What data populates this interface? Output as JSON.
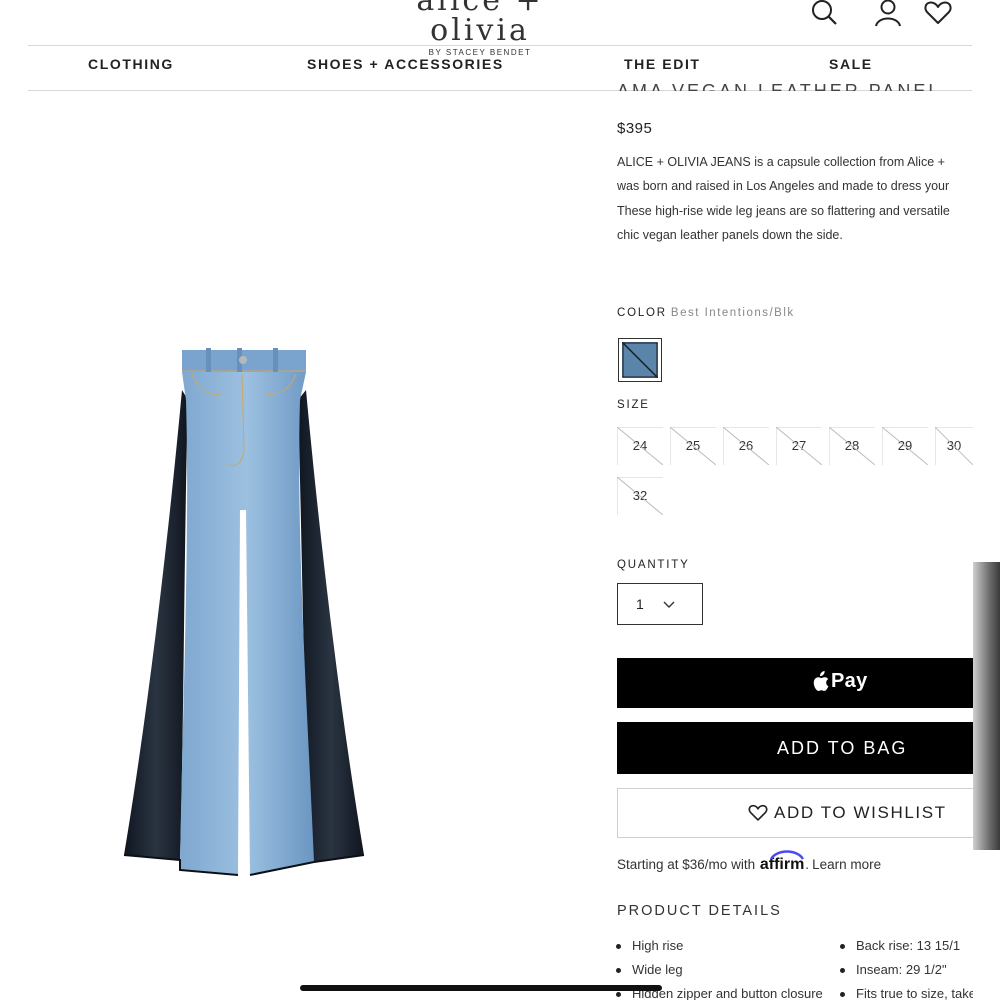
{
  "header": {
    "logo_main": "alice + olivia",
    "logo_sub": "BY STACEY BENDET",
    "icons": [
      "search-icon",
      "account-icon",
      "wishlist-heart-icon"
    ]
  },
  "nav": {
    "items": [
      "CLOTHING",
      "SHOES + ACCESSORIES",
      "THE EDIT",
      "SALE"
    ]
  },
  "product": {
    "title_partial": "AMA VEGAN LEATHER PANEL",
    "price": "$395",
    "description_lines": [
      "ALICE + OLIVIA JEANS is a capsule collection from Alice +",
      "was born and raised in Los Angeles and made to dress your",
      "These high-rise wide leg jeans are so flattering and versatile",
      "chic vegan leather panels down the side."
    ],
    "color_label": "COLOR",
    "color_value": "Best Intentions/Blk",
    "swatch_color": "#5b84aa",
    "size_label": "SIZE",
    "sizes": [
      "24",
      "25",
      "26",
      "27",
      "28",
      "29",
      "30",
      "32"
    ],
    "quantity_label": "QUANTITY",
    "quantity_value": "1",
    "apple_pay_label": "Pay",
    "add_to_bag_label": "ADD TO BAG",
    "add_to_wishlist_label": "ADD TO WISHLIST",
    "affirm_prefix": "Starting at $36/mo with",
    "affirm_brand": "affirm",
    "affirm_suffix": ".",
    "affirm_learn_more": "Learn more",
    "details_title": "PRODUCT DETAILS",
    "details_left": [
      "High rise",
      "Wide leg",
      "Hidden zipper and button closure"
    ],
    "details_right": [
      "Back rise: 13 15/1",
      "Inseam: 29 1/2\"",
      "Fits true to size, take"
    ]
  },
  "colors": {
    "denim_light": "#8fb4d8",
    "denim_mid": "#6d98c4",
    "leather": "#1c2430",
    "button_bg": "#000000"
  }
}
